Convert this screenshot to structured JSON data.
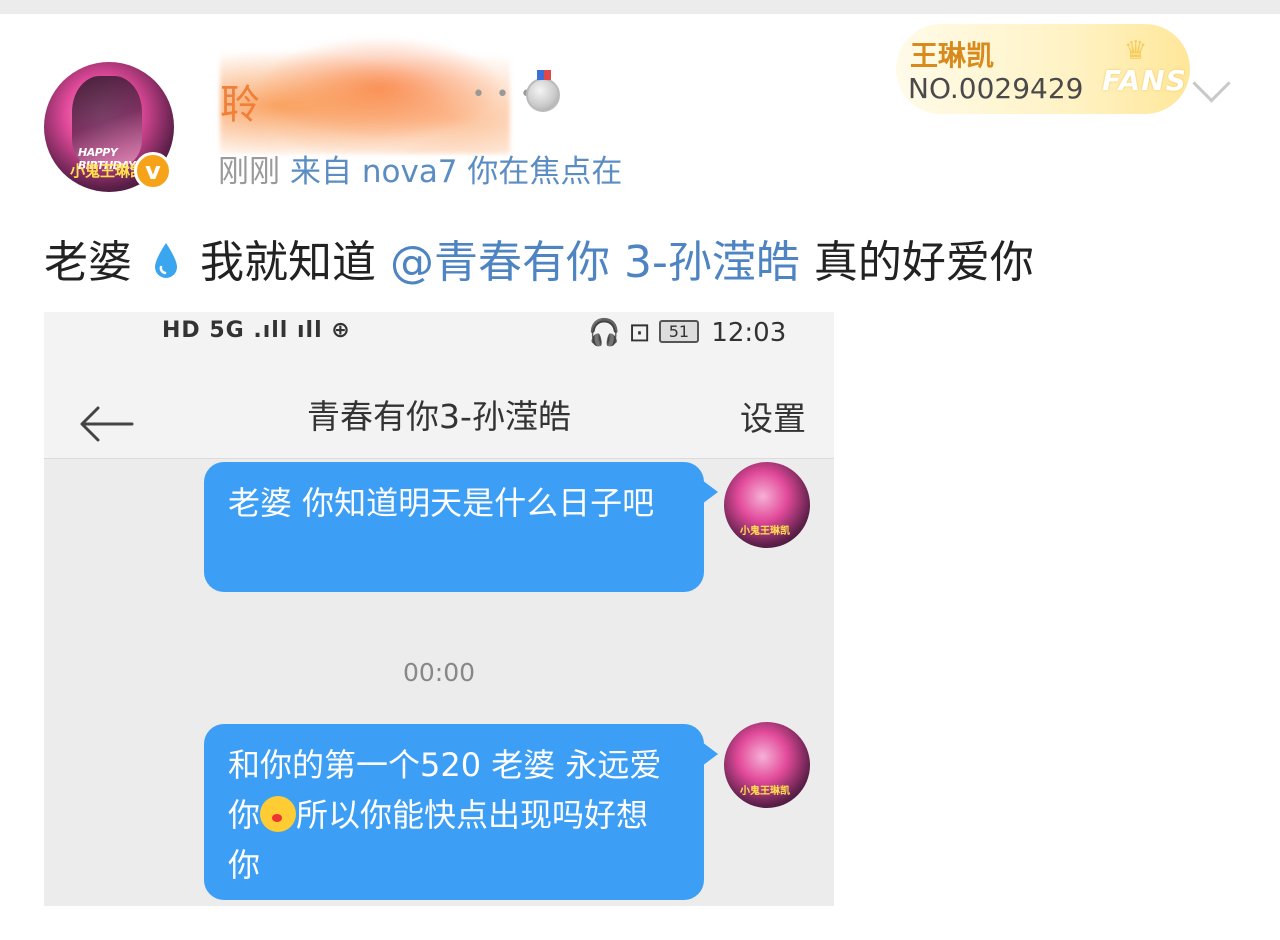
{
  "header": {
    "username_visible": "聆",
    "username_dots": "• • •",
    "time": "刚刚",
    "source": "来自 nova7 你在焦点在",
    "fans_badge": {
      "name": "王琳凯",
      "number": "NO.0029429",
      "label": "FANS"
    },
    "avatar_text_1": "HAPPY BIRTHDAY",
    "avatar_text_2": "小鬼王琳凯",
    "verified_mark": "v"
  },
  "post": {
    "part1": "老婆",
    "part2": "我就知道",
    "mention": "@青春有你 3-孙滢皓",
    "part3": "真的好爱你"
  },
  "screenshot": {
    "status_left": "HD 5G .ıll ıll ⊕",
    "status_icons": "🎧 ⊡",
    "battery": "51",
    "time": "12:03",
    "chat_title": "青春有你3-孙滢皓",
    "settings_label": "设置",
    "messages": [
      {
        "text": "老婆 你知道明天是什么日子吧"
      },
      {
        "text_a": "和你的第一个520 老婆 永远爱你",
        "text_b": "所以你能快点出现吗好想你"
      }
    ],
    "timestamp": "00:00",
    "mini_avatar_text": "小鬼王琳凯"
  },
  "colors": {
    "mention": "#4e84c1",
    "bubble": "#3d9ef5",
    "verified": "#f7a31a",
    "fans_name": "#d98a1c"
  }
}
